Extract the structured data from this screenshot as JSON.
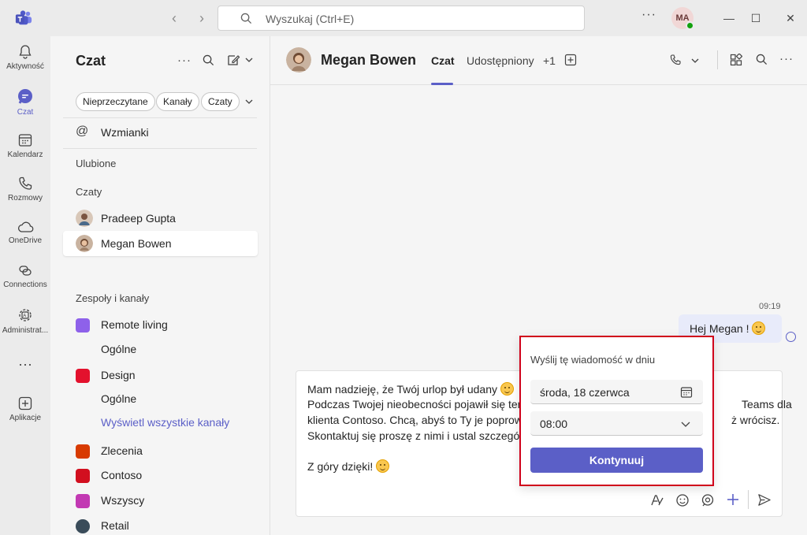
{
  "titlebar": {
    "search_placeholder": "Wyszukaj (Ctrl+E)",
    "more": "···",
    "user_initials": "MA",
    "back_arrow": "‹",
    "forward_arrow": "›",
    "minimize": "—",
    "maximize": "☐",
    "close": "✕"
  },
  "rail": {
    "items": [
      {
        "label": "Aktywność",
        "icon": "bell-icon"
      },
      {
        "label": "Czat",
        "icon": "chat-icon"
      },
      {
        "label": "Kalendarz",
        "icon": "calendar-icon"
      },
      {
        "label": "Rozmowy",
        "icon": "phone-icon"
      },
      {
        "label": "OneDrive",
        "icon": "cloud-icon"
      },
      {
        "label": "Connections",
        "icon": "connections-icon"
      },
      {
        "label": "Administrat...",
        "icon": "admin-icon"
      },
      {
        "label": "Aplikacje",
        "icon": "add-app-icon"
      }
    ],
    "more": "···"
  },
  "chatlist": {
    "title": "Czat",
    "filters": [
      "Nieprzeczytane",
      "Kanały",
      "Czaty"
    ],
    "mentions": "Wzmianki",
    "favorites": "Ulubione",
    "chats_section": "Czaty",
    "people": [
      "Pradeep Gupta",
      "Megan Bowen"
    ],
    "teams_section": "Zespoły i kanały",
    "teams": [
      {
        "name": "Remote living",
        "color": "#8e61ea",
        "channel": "Ogólne"
      },
      {
        "name": "Design",
        "color": "#e3112d",
        "channel": "Ogólne",
        "link": "Wyświetl wszystkie kanały"
      },
      {
        "name": "Zlecenia",
        "color": "#d83b01"
      },
      {
        "name": "Contoso",
        "color": "#d20f1f"
      },
      {
        "name": "Wszyscy",
        "color": "#c239b3"
      },
      {
        "name": "Retail",
        "color": "#3a4c5a"
      }
    ]
  },
  "chat": {
    "name": "Megan Bowen",
    "tabs": [
      "Czat",
      "Udostępniony",
      "+1"
    ],
    "message_time": "09:19",
    "message_text": "Hej Megan !",
    "composer_lines": [
      "Mam nadzieję, że Twój urlop był udany",
      "Podczas Twojej nieobecności pojawił się tem",
      "klienta Contoso. Chcą, abyś to Ty je poprowa",
      "Skontaktuj się proszę z nimi i ustal szczegóły",
      "Z góry dzięki!"
    ],
    "composer_right": [
      "Teams dla",
      "ż wrócisz."
    ]
  },
  "schedule": {
    "title": "Wyślij tę wiadomość w dniu",
    "date": "środa, 18 czerwca",
    "time": "08:00",
    "button": "Kontynuuj"
  },
  "colors": {
    "accent": "#5b5fc7",
    "highlight": "#d0021b"
  }
}
